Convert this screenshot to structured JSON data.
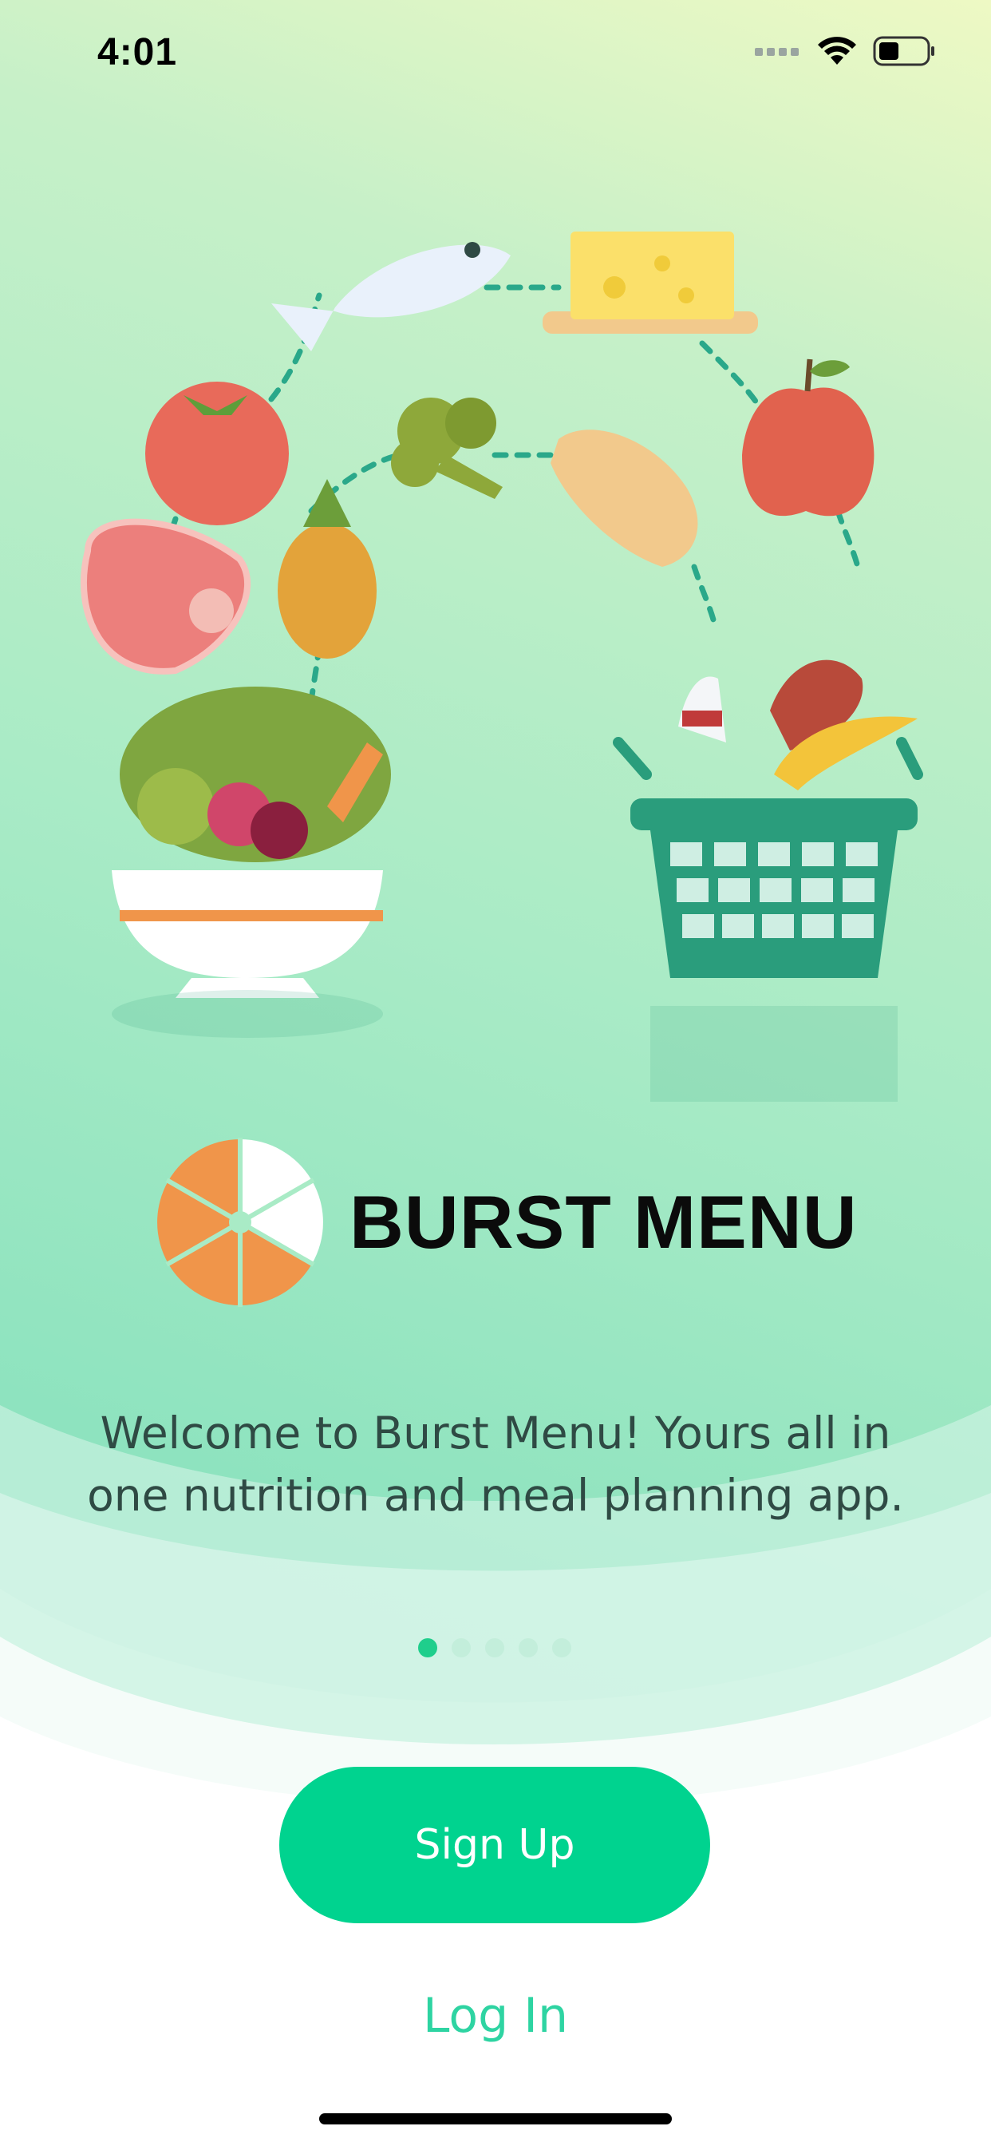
{
  "status_bar": {
    "time": "4:01"
  },
  "brand": {
    "name": "BURST MENU"
  },
  "welcome": {
    "line1": "Welcome to Burst Menu! Yours all in",
    "line2": "one nutrition and meal planning app."
  },
  "pagination": {
    "total": 5,
    "active": 1
  },
  "actions": {
    "signup_label": "Sign Up",
    "login_label": "Log In"
  },
  "colors": {
    "primary": "#00d38f",
    "link": "#2ed4a2",
    "brand_orange": "#f0954a"
  }
}
